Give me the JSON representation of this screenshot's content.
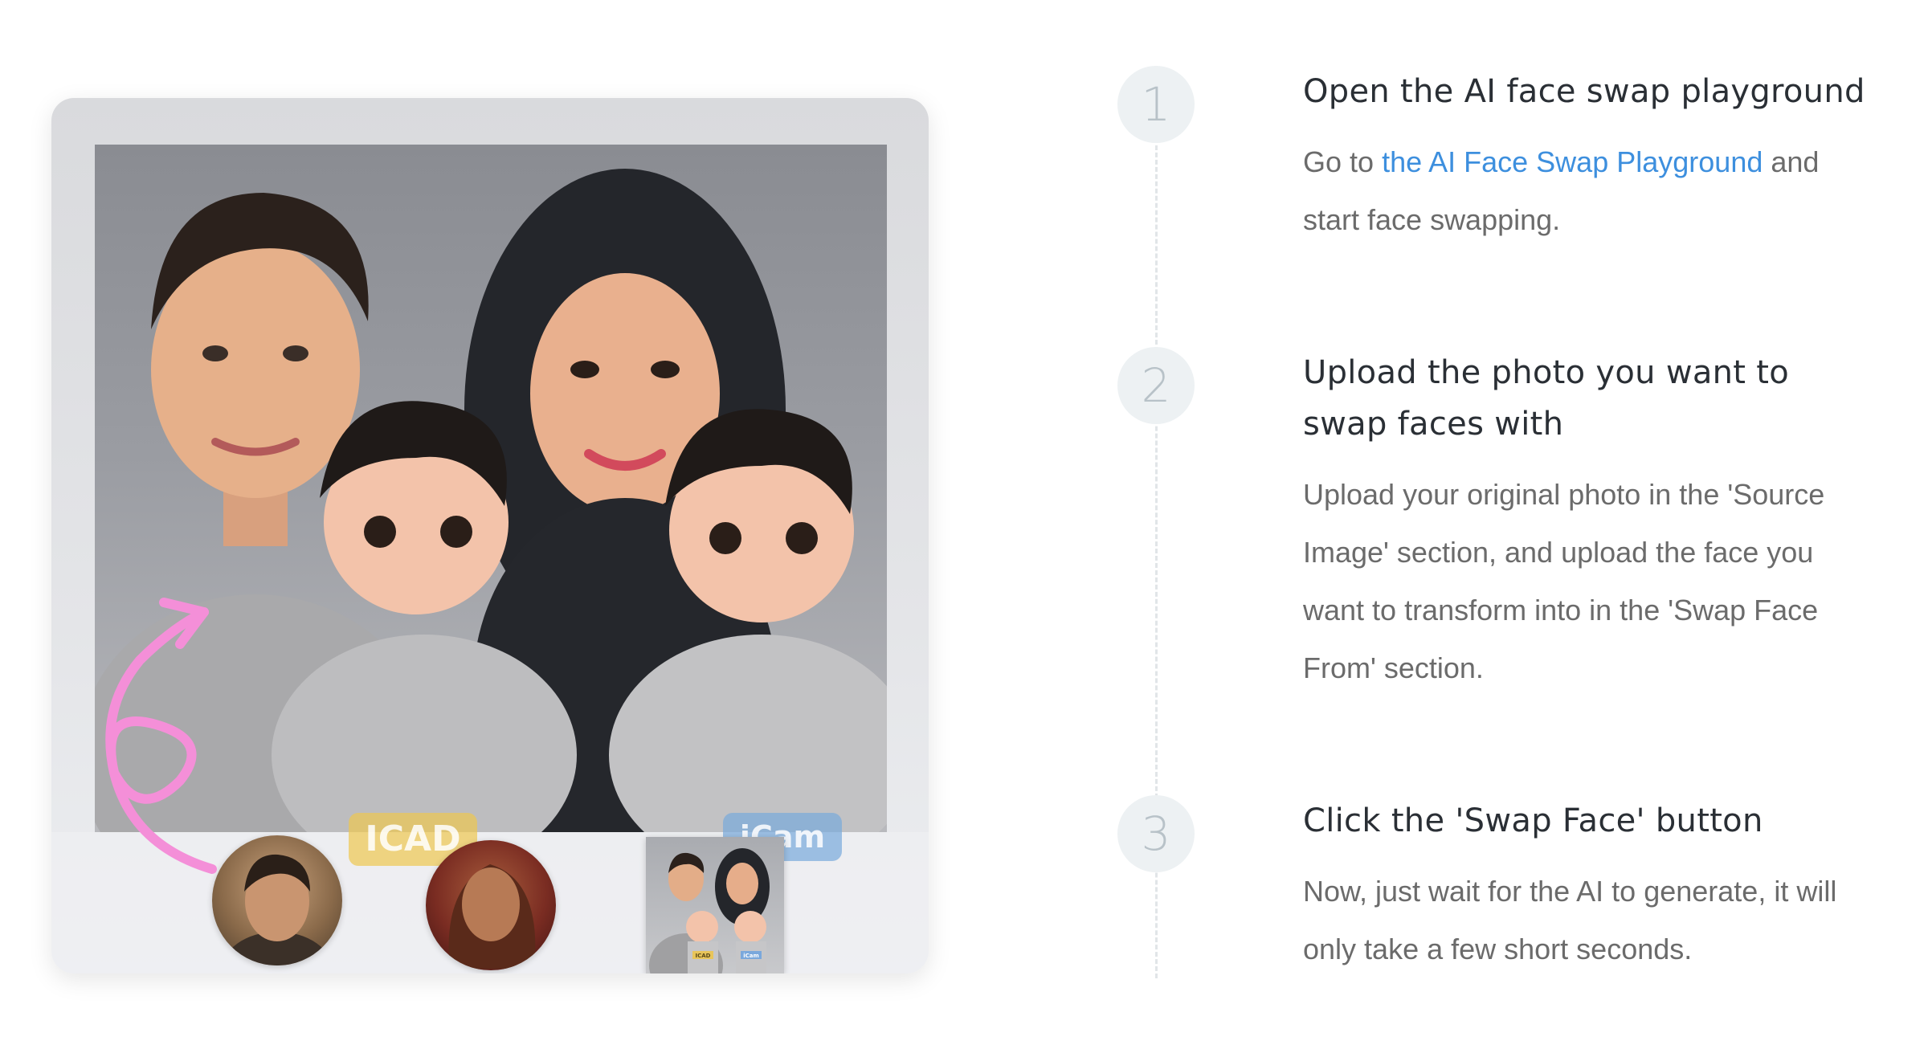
{
  "illustration": {
    "shirt_labels": [
      "ICAD",
      "iCam"
    ],
    "thumb_shirt_labels": [
      "ICAD",
      "iCam"
    ],
    "accent_color": "#f48fd8"
  },
  "steps": [
    {
      "number": "1",
      "title": "Open the AI face swap playground",
      "desc_prefix": "Go to ",
      "link_text": "the AI Face Swap Playground",
      "desc_suffix": " and start face swapping."
    },
    {
      "number": "2",
      "title": "Upload the photo you want to swap faces with",
      "desc": "Upload your original photo in the 'Source Image' section, and upload the face you want to transform into in the 'Swap Face From' section."
    },
    {
      "number": "3",
      "title": "Click the 'Swap Face' button",
      "desc": "Now, just wait for the AI to generate, it will only take a few short seconds."
    }
  ],
  "colors": {
    "link": "#3d8fde",
    "title": "#2a2f35",
    "body": "#6b6b6b",
    "step_circle": "#edf1f3",
    "step_number": "#b8c2c8"
  }
}
